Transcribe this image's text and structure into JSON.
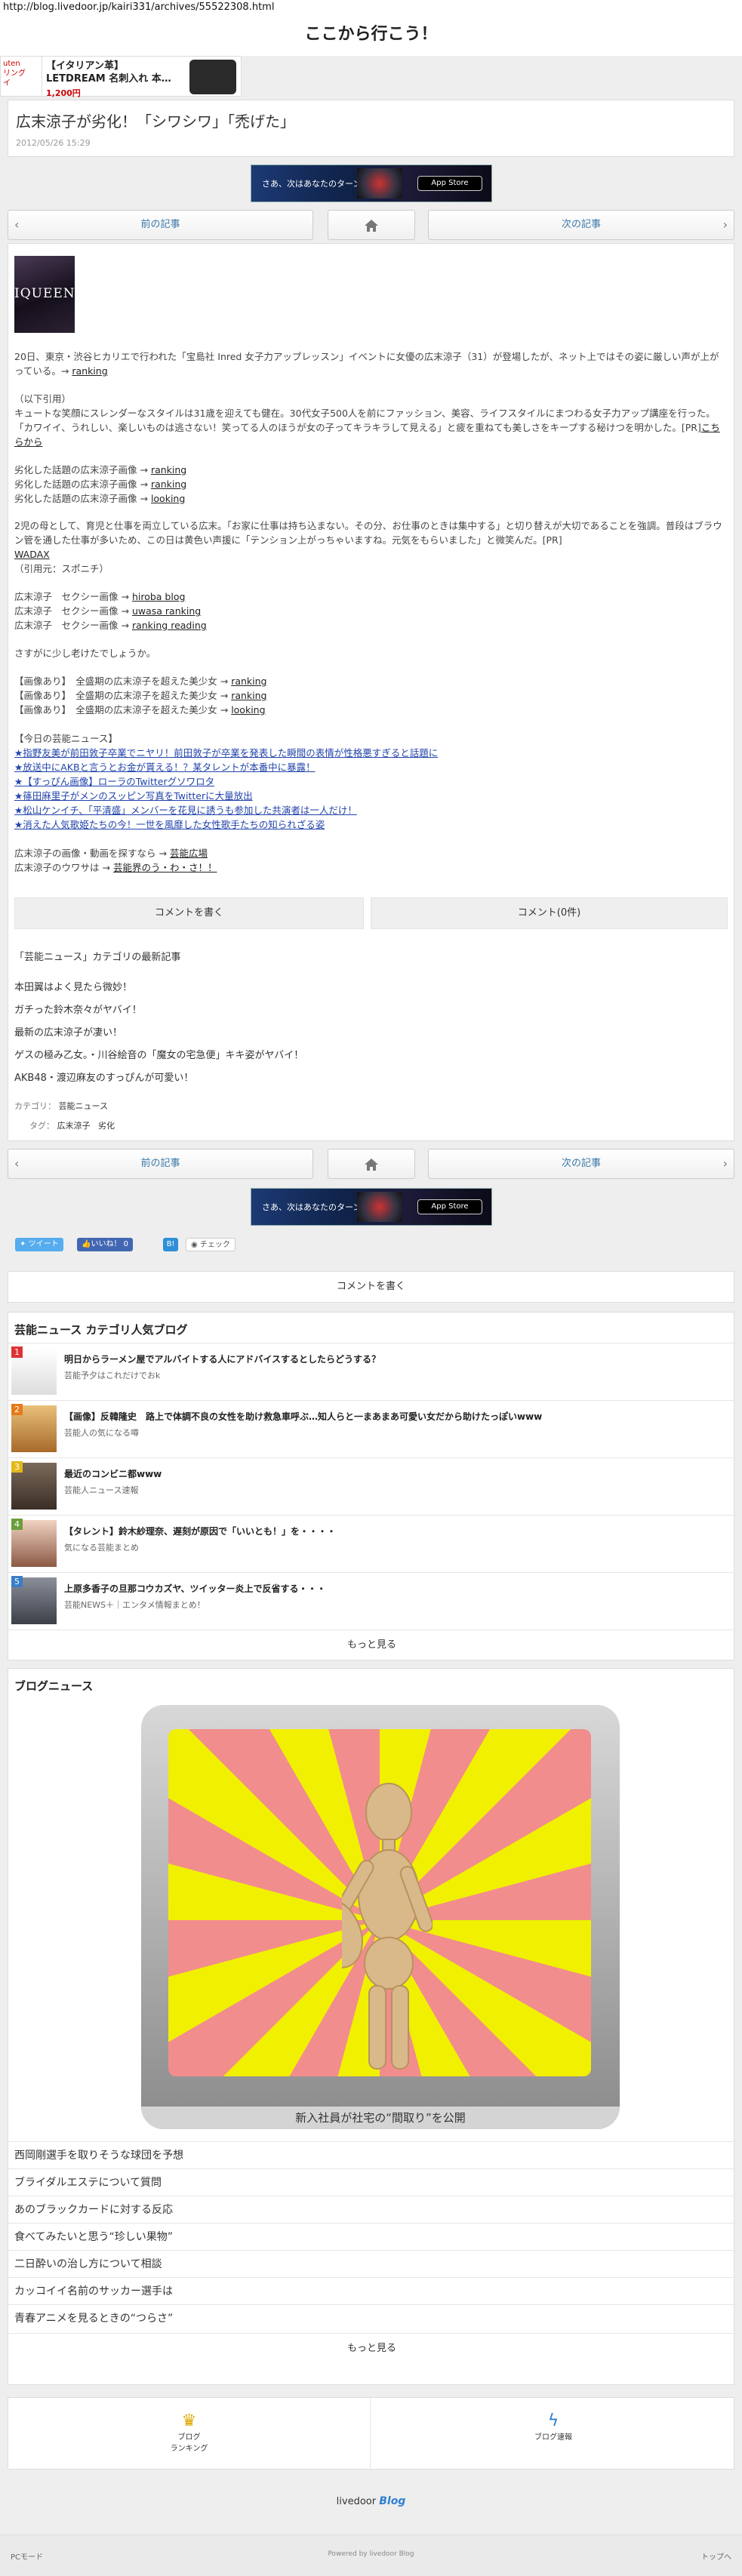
{
  "browser": {
    "url": "http://blog.livedoor.jp/kairi331/archives/55522308.html"
  },
  "site": {
    "title": "ここから行こう！"
  },
  "top_ad": {
    "rank_label": "uten",
    "rank_label2": "リング",
    "rank_label3": "イ",
    "headline1": "【イタリアン革】",
    "headline2": "LETDREAM 名刺入れ 本…",
    "price": "1,200円"
  },
  "post": {
    "title": "広末涼子が劣化！「シワシワ」「禿げた」",
    "date": "2012/05/26 15:29"
  },
  "banner": {
    "text": "さあ、次はあなたのターン",
    "store": " App Store"
  },
  "nav": {
    "prev": "前の記事",
    "next": "次の記事"
  },
  "article": {
    "thumb_text": "IQUEEN",
    "p1": "20日、東京・渋谷ヒカリエで行われた「宝島社 Inred 女子力アップレッスン」イベントに女優の広末涼子（31）が登場したが、ネット上ではその姿に厳しい声が上がっている。→",
    "link_ranking": "ranking",
    "quote_head": "（以下引用）",
    "quote": "キュートな笑顔にスレンダーなスタイルは31歳を迎えても健在。30代女子500人を前にファッション、美容、ライフスタイルにまつわる女子力アップ講座を行った。「カワイイ、うれしい、楽しいものは逃さない！笑ってる人のほうが女の子ってキラキラして見える」と疲を重ねても美しさをキープする秘けつを明かした。[PR]",
    "pr_link": "こちらから",
    "rel1": "劣化した話題の広末涼子画像 →",
    "rel2": "劣化した話題の広末涼子画像 →",
    "rel3": "劣化した話題の広末涼子画像 →",
    "link_looking": "looking",
    "p2": "2児の母として、育児と仕事を両立している広末。「お家に仕事は持ち込まない。その分、お仕事のときは集中する」と切り替えが大切であることを強調。普段はブラウン管を通した仕事が多いため、この日は黄色い声援に「テンション上がっちゃいますね。元気をもらいました」と微笑んだ。[PR]",
    "wadax": "WADAX",
    "source": "（引用元：スポニチ）",
    "sx1": "広末涼子　セクシー画像 →",
    "sx1_link": "hiroba blog",
    "sx2": "広末涼子　セクシー画像 →",
    "sx2_link": "uwasa ranking",
    "sx3": "広末涼子　セクシー画像 →",
    "sx3_link": "ranking reading",
    "p3": "さすがに少し老けたでしょうか。",
    "im1": "【画像あり】　全盛期の広末涼子を超えた美少女 →",
    "im2": "【画像あり】　全盛期の広末涼子を超えた美少女 →",
    "im3": "【画像あり】　全盛期の広末涼子を超えた美少女 →",
    "today_head": "【今日の芸能ニュース】",
    "news": [
      "★指野友美が前田敦子卒業でニヤリ！前田敦子が卒業を発表した瞬間の表情が性格悪すぎると話題に",
      "★放送中にAKBと言うとお金が貰える！？某タレントが本番中に暴露！",
      "★【すっぴん画像】ローラのTwitterグソワロタ",
      "★篠田麻里子がメンのスッピン写真をTwitterに大量放出",
      "★松山ケンイチ、「平清盛」メンバーを花見に誘うも参加した共演者は一人だけ！",
      "★消えた人気歌姫たちの今！一世を風靡した女性歌手たちの知られざる姿"
    ],
    "more1": "広末涼子の画像・動画を探すなら →",
    "more1_link": "芸能広場",
    "more2": "広末涼子のウワサは →",
    "more2_link": "芸能界のう・わ・さ！！"
  },
  "comment": {
    "write": "コメントを書く",
    "count": "コメント(0件)"
  },
  "category": {
    "heading": "「芸能ニュース」カテゴリの最新記事",
    "items": [
      "本田翼はよく見たら微妙！",
      "ガチった鈴木奈々がヤバイ！",
      "最新の広末涼子が凄い！",
      "ゲスの極み乙女。・川谷絵音の「魔女の宅急便」キキ姿がヤバイ！",
      "AKB48・渡辺麻友のすっぴんが可愛い！"
    ],
    "category_label": "カテゴリ：",
    "category_value": "芸能ニュース",
    "tag_label": "タグ：",
    "tags": [
      "広末涼子",
      "劣化"
    ]
  },
  "social": {
    "tweet": "ツイート",
    "like": "いいね！",
    "like_count": "0",
    "check": "チェック"
  },
  "comment2": {
    "write": "コメントを書く"
  },
  "popular": {
    "heading": "芸能ニュース カテゴリ人気ブログ",
    "items": [
      {
        "rank": "1",
        "title": "明日からラーメン屋でアルバイトする人にアドバイスするとしたらどうする？",
        "blog": "芸能予夕はこれだけでおk"
      },
      {
        "rank": "2",
        "title": "【画像】反韓隆史　路上で体調不良の女性を助け救急車呼ぶ…知人らと一まあまあ可愛い女だから助けたっぽいwww",
        "blog": "芸能人の気になる噂"
      },
      {
        "rank": "3",
        "title": "最近のコンビニ都www",
        "blog": "芸能人ニュース速報"
      },
      {
        "rank": "4",
        "title": "【タレント】鈴木紗理奈、遅刻が原因で「いいとも！」を・・・・",
        "blog": "気になる芸能まとめ"
      },
      {
        "rank": "5",
        "title": "上原多香子の旦那コウカズヤ、ツイッター炎上で反省する・・・",
        "blog": "芸能NEWS＋｜エンタメ情報まとめ！"
      }
    ],
    "more": "もっと見る"
  },
  "blog_news": {
    "heading": "ブログニュース",
    "feature_caption": "新入社員が社宅の“間取り”を公開",
    "items": [
      "西岡剛選手を取りそうな球団を予想",
      "ブライダルエステについて質問",
      "あのブラックカードに対する反応",
      "食べてみたいと思う“珍しい果物”",
      "二日酔いの治し方について相談",
      "カッコイイ名前のサッカー選手は",
      "青春アニメを見るときの“つらさ”"
    ],
    "more": "もっと見る"
  },
  "footer": {
    "ranking1": "ブログ",
    "ranking2": "ランキング",
    "speed": "ブログ速報",
    "brand": "livedoor",
    "brand2": "Blog",
    "pc": "PCモード",
    "powered": "Powered by livedoor Blog",
    "top": "トップへ"
  }
}
